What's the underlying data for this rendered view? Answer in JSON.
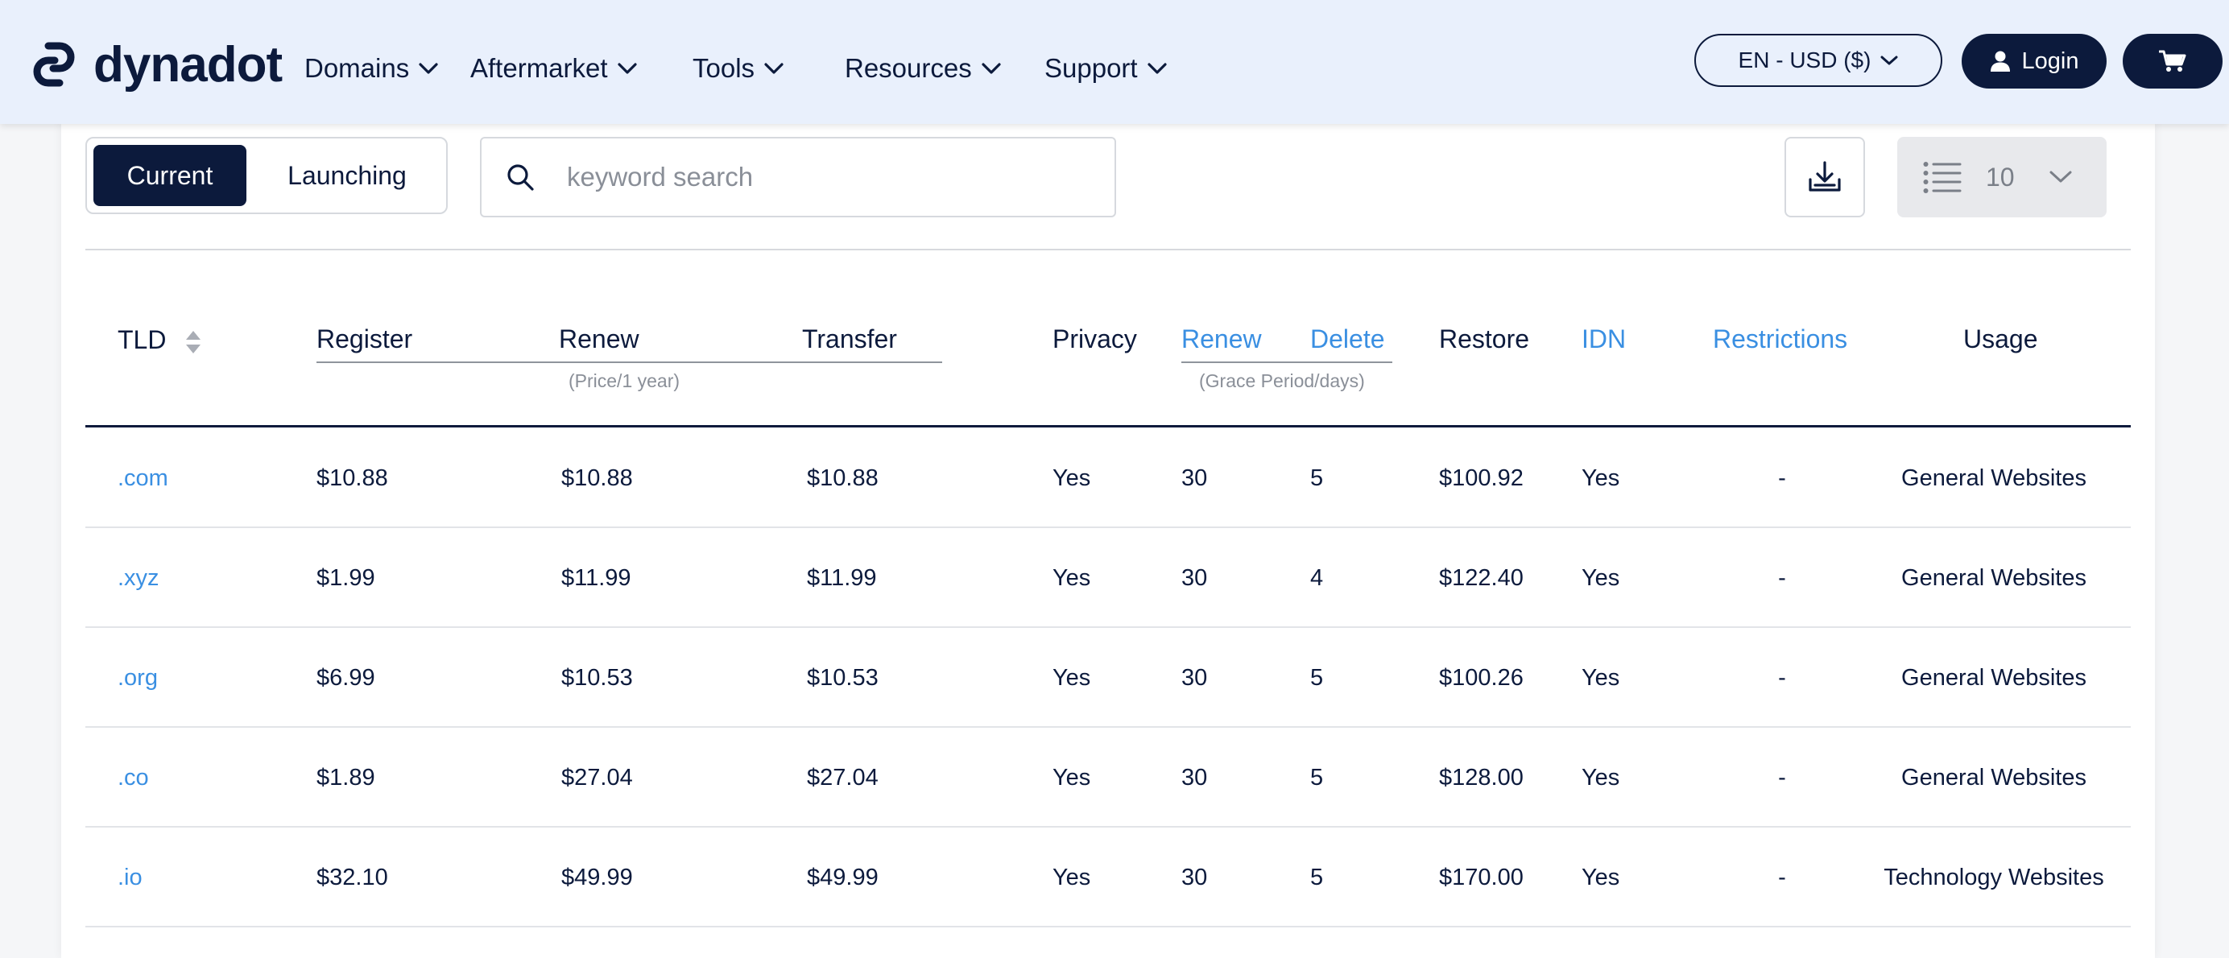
{
  "header": {
    "logo_text": "dynadot",
    "nav": [
      {
        "label": "Domains"
      },
      {
        "label": "Aftermarket"
      },
      {
        "label": "Tools"
      },
      {
        "label": "Resources"
      },
      {
        "label": "Support"
      }
    ],
    "lang_currency": "EN - USD ($)",
    "login_label": "Login",
    "cart_icon": "cart-icon"
  },
  "toolbar": {
    "tabs": [
      {
        "label": "Current",
        "active": true
      },
      {
        "label": "Launching",
        "active": false
      }
    ],
    "search_placeholder": "keyword search",
    "search_value": "",
    "per_page": "10"
  },
  "table": {
    "headers": {
      "tld": "TLD",
      "register": "Register",
      "renew": "Renew",
      "transfer": "Transfer",
      "price_note": "(Price/1 year)",
      "privacy": "Privacy",
      "grace_renew": "Renew",
      "grace_delete": "Delete",
      "grace_note": "(Grace Period/days)",
      "restore": "Restore",
      "idn": "IDN",
      "restrictions": "Restrictions",
      "usage": "Usage"
    },
    "rows": [
      {
        "tld": ".com",
        "register": "$10.88",
        "renew": "$10.88",
        "transfer": "$10.88",
        "privacy": "Yes",
        "grace_renew": "30",
        "grace_delete": "5",
        "restore": "$100.92",
        "idn": "Yes",
        "restrictions": "-",
        "usage": "General Websites"
      },
      {
        "tld": ".xyz",
        "register": "$1.99",
        "renew": "$11.99",
        "transfer": "$11.99",
        "privacy": "Yes",
        "grace_renew": "30",
        "grace_delete": "4",
        "restore": "$122.40",
        "idn": "Yes",
        "restrictions": "-",
        "usage": "General Websites"
      },
      {
        "tld": ".org",
        "register": "$6.99",
        "renew": "$10.53",
        "transfer": "$10.53",
        "privacy": "Yes",
        "grace_renew": "30",
        "grace_delete": "5",
        "restore": "$100.26",
        "idn": "Yes",
        "restrictions": "-",
        "usage": "General Websites"
      },
      {
        "tld": ".co",
        "register": "$1.89",
        "renew": "$27.04",
        "transfer": "$27.04",
        "privacy": "Yes",
        "grace_renew": "30",
        "grace_delete": "5",
        "restore": "$128.00",
        "idn": "Yes",
        "restrictions": "-",
        "usage": "General Websites"
      },
      {
        "tld": ".io",
        "register": "$32.10",
        "renew": "$49.99",
        "transfer": "$49.99",
        "privacy": "Yes",
        "grace_renew": "30",
        "grace_delete": "5",
        "restore": "$170.00",
        "idn": "Yes",
        "restrictions": "-",
        "usage": "Technology Websites"
      }
    ]
  },
  "colors": {
    "navy": "#0c1a3c",
    "link_blue": "#3a8fe2",
    "header_bg": "#e9f0fc"
  }
}
